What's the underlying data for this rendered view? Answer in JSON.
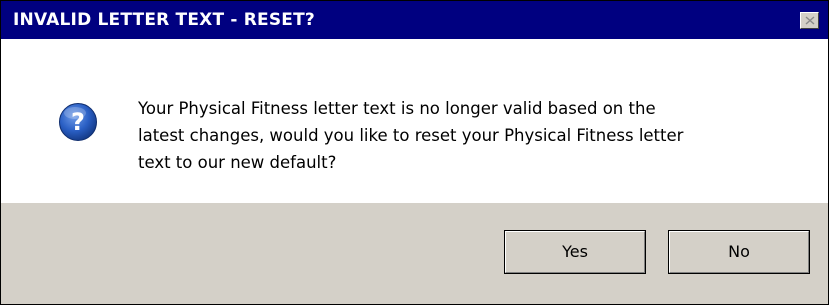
{
  "dialog": {
    "title": "INVALID LETTER TEXT - RESET?",
    "close_icon": "close-icon",
    "icon": "question-icon",
    "message_lines": [
      "Your Physical Fitness letter text is no longer valid based on the",
      "latest changes, would you like to reset your Physical Fitness letter",
      "text to our new default?"
    ],
    "buttons": {
      "yes_label": "Yes",
      "no_label": "No"
    }
  },
  "colors": {
    "titlebar": "#000080",
    "footer": "#d4d0c8",
    "icon_blue": "#2a5fc4"
  }
}
